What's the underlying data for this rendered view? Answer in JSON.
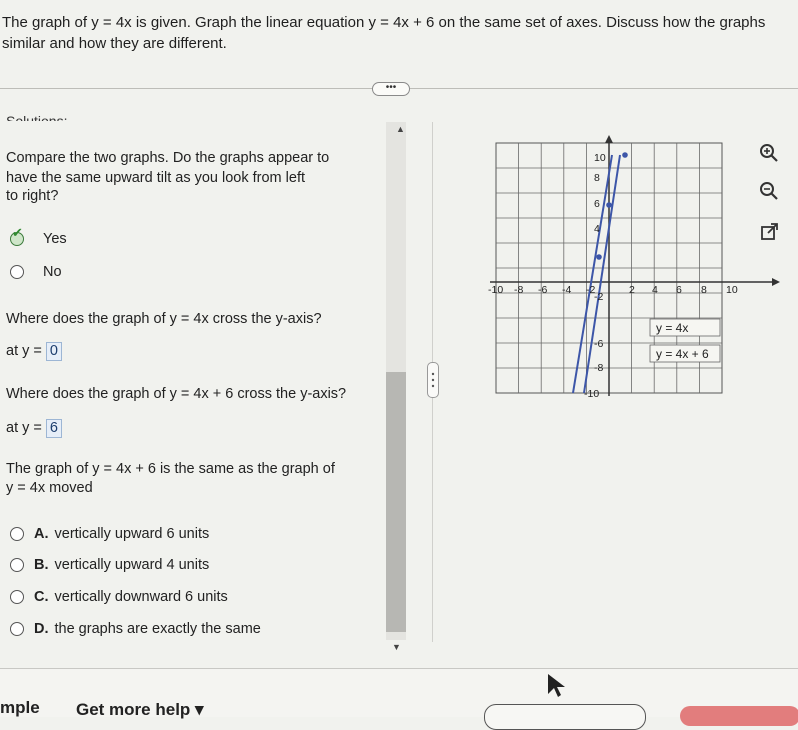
{
  "question": {
    "line1": "The graph of y = 4x is given.  Graph the linear equation y = 4x + 6 on the same set of axes.  Discuss how the graphs",
    "line2": "similar and how they are different."
  },
  "expand_label": "•••",
  "solutions_heading": "Solutions:",
  "part1": {
    "prompt_line1": "Compare the two graphs.  Do the graphs appear to",
    "prompt_line2": "have the same upward tilt as you look from left",
    "prompt_line3": "to right?",
    "options": [
      {
        "label": "Yes",
        "selected": true
      },
      {
        "label": "No",
        "selected": false
      }
    ]
  },
  "part2": {
    "prompt": "Where does the graph of y = 4x cross the y-axis?",
    "answer_prefix": "at y =",
    "answer": "0"
  },
  "part3": {
    "prompt": "Where does the graph of y = 4x + 6 cross the y-axis?",
    "answer_prefix": "at y =",
    "answer": "6"
  },
  "part4": {
    "prompt_line1": "The graph of y = 4x + 6 is the same as the graph of",
    "prompt_line2": "y = 4x moved",
    "options": [
      {
        "letter": "A.",
        "label": "vertically upward 6 units"
      },
      {
        "letter": "B.",
        "label": "vertically upward 4 units"
      },
      {
        "letter": "C.",
        "label": "vertically downward 6 units"
      },
      {
        "letter": "D.",
        "label": "the graphs are exactly the same"
      }
    ]
  },
  "graph": {
    "x_ticks": [
      "-10",
      "-8",
      "-6",
      "-4",
      "-2",
      "2",
      "4",
      "6",
      "8",
      "10"
    ],
    "y_ticks": [
      "10",
      "8",
      "6",
      "4",
      "-2",
      "-6",
      "-8",
      "-10"
    ],
    "label_line1": "y = 4x",
    "label_line2": "y = 4x + 6",
    "line_color": "#3d56a8"
  },
  "tools": {
    "zoom_in": "zoom-in-icon",
    "zoom_out": "zoom-out-icon",
    "popout": "external-link-icon"
  },
  "bottom": {
    "left_text": "mple",
    "help_text": "Get more help ▾"
  }
}
